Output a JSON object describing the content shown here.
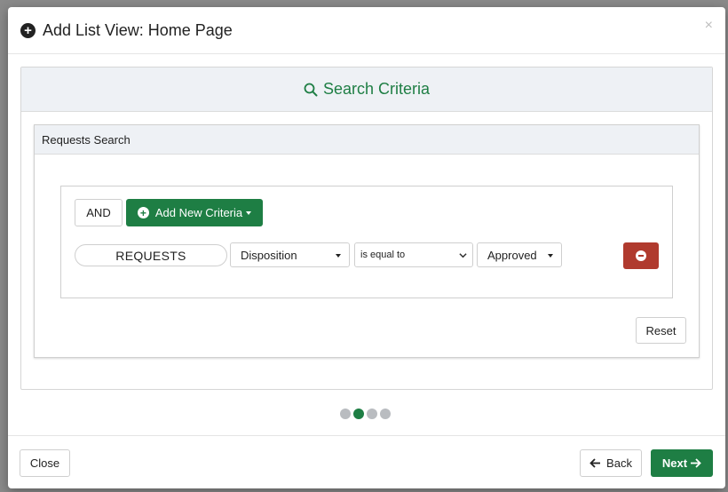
{
  "modal": {
    "title": "Add List View: Home Page",
    "close_glyph": "×"
  },
  "search_panel": {
    "heading": "Search Criteria"
  },
  "requests_search": {
    "heading": "Requests Search",
    "logic_operator": "AND",
    "add_criteria_label": "Add New Criteria",
    "criteria": [
      {
        "entity": "REQUESTS",
        "field": "Disposition",
        "operator": "is equal to",
        "value": "Approved"
      }
    ],
    "reset_label": "Reset"
  },
  "wizard": {
    "total_steps": 4,
    "current_step": 2
  },
  "footer": {
    "close_label": "Close",
    "back_label": "Back",
    "next_label": "Next"
  },
  "colors": {
    "primary_green": "#1e7e44",
    "danger_red": "#b03a2e",
    "panel_header_bg": "#eef1f5"
  },
  "icons": {
    "title": "plus-circle-icon",
    "search": "search-icon",
    "add": "plus-circle-icon",
    "remove": "minus-circle-icon",
    "back": "arrow-left-icon",
    "next": "arrow-right-icon"
  }
}
